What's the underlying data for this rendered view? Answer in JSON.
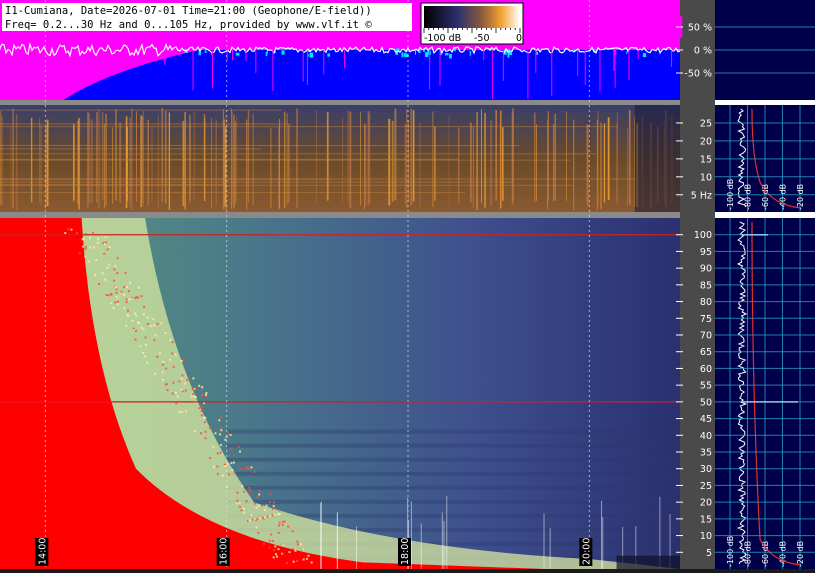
{
  "chart_data": [
    {
      "type": "area",
      "panel": "e-field amplitude (percent)",
      "title": "I1-Cumiana, Date=2026-07-01 Time=21:00 (Geophone/E-field))",
      "subtitle": "Freq= 0.2...30 Hz and 0...105 Hz, provided by www.vlf.it ©",
      "y_tick_labels": [
        "50 %",
        "0 %",
        "-50 %"
      ],
      "y_ticks": [
        50,
        0,
        -50
      ],
      "ylim": [
        -100,
        100
      ],
      "colors": {
        "magenta": "#ff00ff",
        "blue": "#0000ff",
        "signal": "#ffffff",
        "cyan": "#00e5ff"
      }
    },
    {
      "type": "heatmap",
      "panel": "geophone spectrogram 0.2-30 Hz",
      "y_tick_labels": [
        "25",
        "20",
        "15",
        "10",
        "5 Hz"
      ],
      "y_ticks": [
        25,
        20,
        15,
        10,
        5
      ],
      "ylim": [
        0.2,
        30
      ]
    },
    {
      "type": "heatmap",
      "panel": "e-field spectrogram 0-105 Hz",
      "y_tick_labels": [
        "100",
        "95",
        "90",
        "85",
        "80",
        "75",
        "70",
        "65",
        "60",
        "55",
        "50",
        "45",
        "40",
        "35",
        "30",
        "25",
        "20",
        "15",
        "10",
        "5"
      ],
      "y_ticks": [
        100,
        95,
        90,
        85,
        80,
        75,
        70,
        65,
        60,
        55,
        50,
        45,
        40,
        35,
        30,
        25,
        20,
        15,
        10,
        5
      ],
      "ylim": [
        0,
        105
      ],
      "x_tick_labels": [
        "14:00",
        "16:00",
        "18:00",
        "20:00"
      ],
      "x_ticks_hours": [
        14,
        16,
        18,
        20
      ],
      "xlim_hours": [
        13.5,
        21.0
      ],
      "spectral_lines_hz": [
        100,
        50
      ]
    },
    {
      "type": "line",
      "panel": "average spectrum, geophone",
      "x_tick_labels": [
        "-20 dB",
        "-40 dB",
        "-60 dB",
        "-80 dB",
        "-100 dB"
      ],
      "x_ticks": [
        -20,
        -40,
        -60,
        -80,
        -100
      ]
    },
    {
      "type": "line",
      "panel": "average spectrum, e-field",
      "x_tick_labels": [
        "-20 dB",
        "-40 dB",
        "-60 dB",
        "-80 dB",
        "-100 dB"
      ],
      "x_ticks": [
        -20,
        -40,
        -60,
        -80,
        -100
      ]
    }
  ],
  "colorbar": {
    "labels": [
      "-100 dB",
      "-50",
      "0"
    ],
    "values": [
      -100,
      -50,
      0
    ]
  },
  "colors": {
    "red_noise": "#ff0000",
    "spectrum_bg": "#4a5a9a",
    "geo_bg": "#5a4630",
    "side_bg": "#00004a",
    "grid_cyan": "#2aa0c8",
    "divider": "#8a8a8a"
  }
}
